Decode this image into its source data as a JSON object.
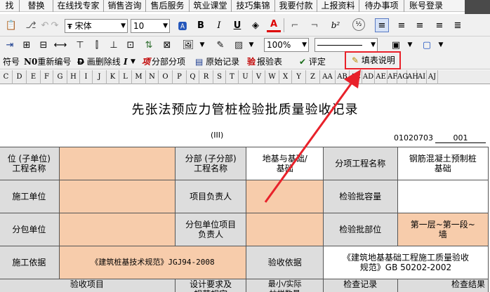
{
  "menu": {
    "items": [
      "找",
      "替换",
      "在线找专家",
      "销售咨询",
      "售后服务",
      "筑业课堂",
      "技巧集锦",
      "我要付款",
      "上报资料",
      "待办事项",
      "账号登录"
    ]
  },
  "toolbar": {
    "font_name": "宋体",
    "font_size": "10",
    "bold": "B",
    "italic": "I",
    "underline": "U",
    "superscript": "b²",
    "zoom": "100%"
  },
  "toolbar3": {
    "symbol": "符号",
    "renumber": "重新编号",
    "strike": "画删除线",
    "split_item": "分部分项",
    "original_record": "原始记录",
    "report_table": "报验表",
    "evaluate": "评定",
    "fill_desc": "填表说明"
  },
  "columns": [
    "C",
    "D",
    "E",
    "F",
    "G",
    "H",
    "I",
    "J",
    "K",
    "L",
    "M",
    "N",
    "O",
    "P",
    "Q",
    "R",
    "S",
    "T",
    "U",
    "V",
    "W",
    "X",
    "Y",
    "Z",
    "AA",
    "AB",
    "AC",
    "AD",
    "AE",
    "AF",
    "AG",
    "AH",
    "AI",
    "AJ"
  ],
  "document": {
    "title": "先张法预应力管桩检验批质量验收记录",
    "subtitle": "(III)",
    "code": "01020703",
    "number": "001",
    "rows": {
      "r1": {
        "a": "位 (子单位)\n工程名称",
        "b": "",
        "c": "分部 (子分部)\n工程名称",
        "d": "地基与基础/\n基础",
        "e": "分项工程名称",
        "f": "钢筋混凝土预制桩\n基础"
      },
      "r2": {
        "a": "施工单位",
        "c": "项目负责人",
        "e": "检验批容量"
      },
      "r3": {
        "a": "分包单位",
        "c": "分包单位项目\n负责人",
        "e": "检验批部位",
        "f": "第一层~第一段~\n墙"
      },
      "r4": {
        "a": "施工依据",
        "b": "《建筑桩基技术规范》JGJ94-2008",
        "c": "验收依据",
        "d": "《建筑地基基础工程施工质量验收\n规范》GB 50202-2002"
      },
      "r5": {
        "a": "验收项目",
        "b": "设计要求及\n规范规定",
        "c": "最小/实际\n抽样数量",
        "d": "检查记录",
        "e": "检查结果"
      }
    }
  },
  "colors": {
    "peach": "#f7ccab",
    "grey": "#dddddd",
    "arrow": "#e8212a"
  }
}
